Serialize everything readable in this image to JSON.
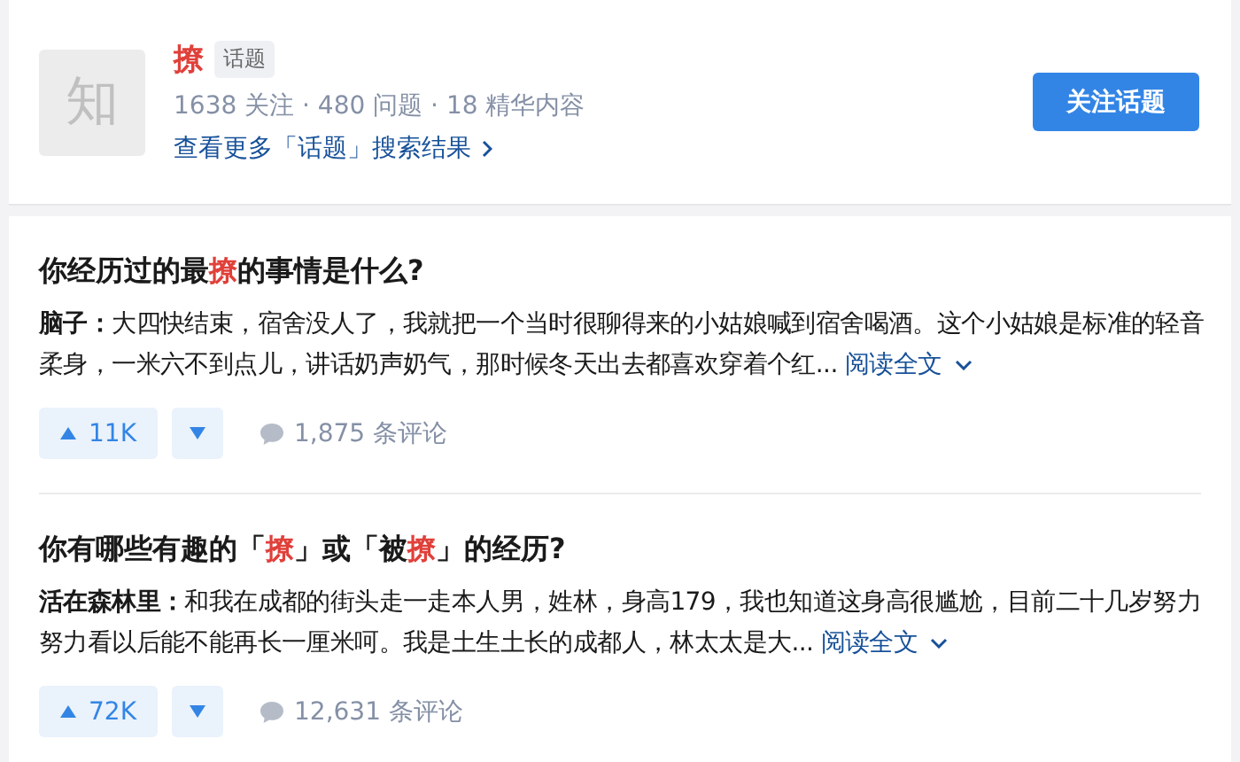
{
  "topic": {
    "avatar_char": "知",
    "name": "撩",
    "tag": "话题",
    "stats": "1638 关注 · 480 问题 · 18 精华内容",
    "more_link": "查看更多「话题」搜索结果",
    "follow_button": "关注话题"
  },
  "answers": [
    {
      "title": [
        {
          "text": "你经历过的最",
          "highlight": false
        },
        {
          "text": "撩",
          "highlight": true
        },
        {
          "text": "的事情是什么?",
          "highlight": false
        }
      ],
      "excerpt": "**脑子：**大四快结束，宿舍没人了，我就把一个当时很聊得来的小姑娘喊到宿舍喝酒。这个小姑娘是标准的轻音柔身，一米六不到点儿，讲话奶声奶气，那时候冬天出去都喜欢穿着个红...",
      "read_more": "阅读全文",
      "upvotes": "11K",
      "comments": "1,875 条评论"
    },
    {
      "title": [
        {
          "text": "你有哪些有趣的「",
          "highlight": false
        },
        {
          "text": "撩",
          "highlight": true
        },
        {
          "text": "」或「被",
          "highlight": false
        },
        {
          "text": "撩",
          "highlight": true
        },
        {
          "text": "」的经历?",
          "highlight": false
        }
      ],
      "excerpt": "**活在森林里：**和我在成都的街头走一走本人男，姓林，身高179，我也知道这身高很尴尬，目前二十几岁努力努力看以后能不能再长一厘米呵。我是土生土长的成都人，林太太是大...",
      "read_more": "阅读全文",
      "upvotes": "72K",
      "comments": "12,631 条评论"
    }
  ]
}
